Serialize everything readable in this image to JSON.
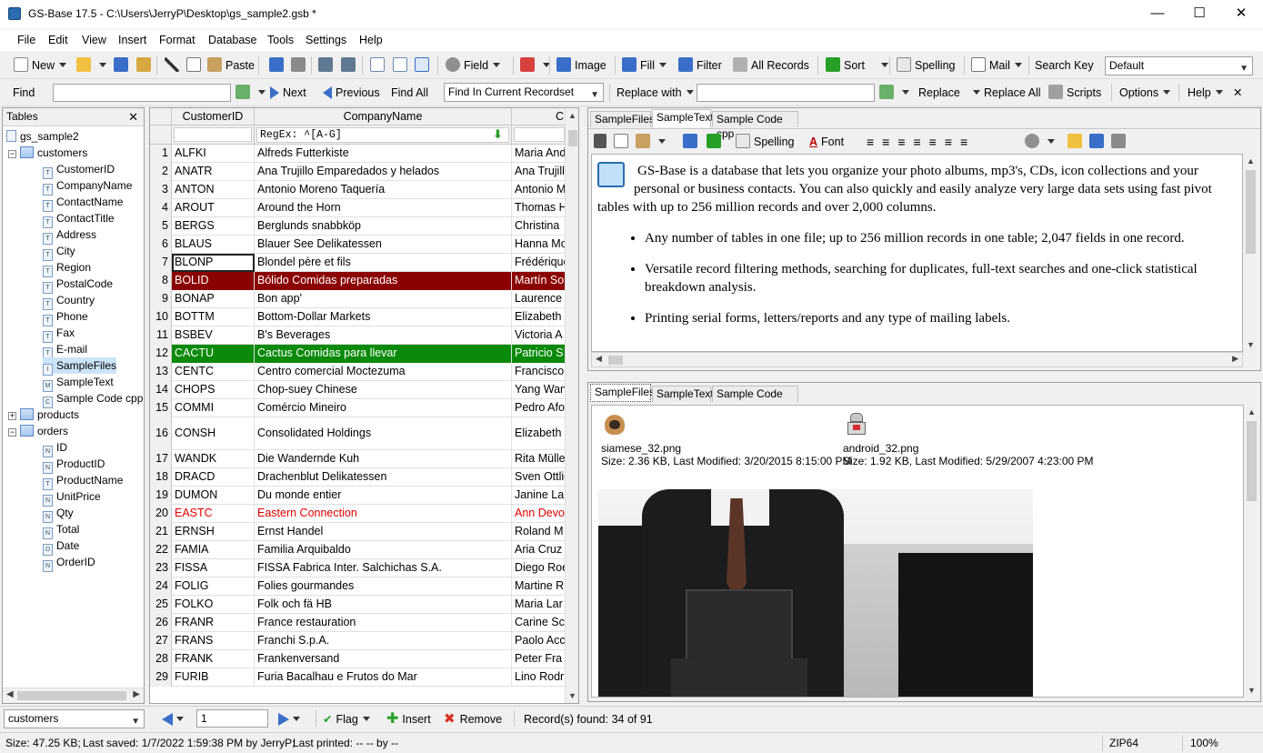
{
  "window": {
    "title": "GS-Base 17.5 - C:\\Users\\JerryP\\Desktop\\gs_sample2.gsb *",
    "minimize": "—",
    "maximize": "☐",
    "close": "✕"
  },
  "menu": [
    "File",
    "Edit",
    "View",
    "Insert",
    "Format",
    "Database",
    "Tools",
    "Settings",
    "Help"
  ],
  "toolbar1": {
    "new": "New",
    "paste": "Paste",
    "field": "Field",
    "image": "Image",
    "fill": "Fill",
    "filter": "Filter",
    "all_records": "All Records",
    "sort": "Sort",
    "spelling": "Spelling",
    "mail": "Mail",
    "search_key": "Search Key",
    "search_key_value": "Default"
  },
  "toolbar2": {
    "find": "Find",
    "find_value": "",
    "next": "Next",
    "previous": "Previous",
    "find_all": "Find All",
    "scope": "Find In Current Recordset",
    "replace_with": "Replace with",
    "replace_value": "",
    "replace": "Replace",
    "replace_all": "Replace All",
    "scripts": "Scripts",
    "options": "Options",
    "help": "Help"
  },
  "tables_panel": {
    "title": "Tables",
    "close": "✕",
    "root": "gs_sample2",
    "tables": [
      {
        "name": "customers",
        "expanded": true,
        "fields": [
          "CustomerID",
          "CompanyName",
          "ContactName",
          "ContactTitle",
          "Address",
          "City",
          "Region",
          "PostalCode",
          "Country",
          "Phone",
          "Fax",
          "E-mail",
          "SampleFiles",
          "SampleText",
          "Sample Code cpp"
        ],
        "field_icons": [
          "T",
          "T",
          "T",
          "T",
          "T",
          "T",
          "T",
          "T",
          "T",
          "T",
          "T",
          "T",
          "I",
          "M",
          "C"
        ]
      },
      {
        "name": "products",
        "expanded": false,
        "fields": []
      },
      {
        "name": "orders",
        "expanded": true,
        "fields": [
          "ID",
          "ProductID",
          "ProductName",
          "UnitPrice",
          "Qty",
          "Total",
          "Date",
          "OrderID"
        ],
        "field_icons": [
          "N",
          "N",
          "T",
          "N",
          "N",
          "N",
          "D",
          "N"
        ]
      }
    ],
    "selected_field": "SampleFiles"
  },
  "grid": {
    "columns": [
      "CustomerID",
      "CompanyName",
      "C"
    ],
    "filter": "RegEx: ^[A-G]",
    "rows": [
      {
        "n": "1",
        "id": "ALFKI",
        "company": "Alfreds Futterkiste",
        "contact": "Maria Anders"
      },
      {
        "n": "2",
        "id": "ANATR",
        "company": "Ana Trujillo Emparedados y helados",
        "contact": "Ana Trujillo"
      },
      {
        "n": "3",
        "id": "ANTON",
        "company": "Antonio Moreno Taquería",
        "contact": "Antonio Moreno"
      },
      {
        "n": "4",
        "id": "AROUT",
        "company": "Around the Horn",
        "contact": "Thomas Hardy"
      },
      {
        "n": "5",
        "id": "BERGS",
        "company": "Berglunds snabbköp",
        "contact": "Christina"
      },
      {
        "n": "6",
        "id": "BLAUS",
        "company": "Blauer See Delikatessen",
        "contact": "Hanna Moos"
      },
      {
        "n": "7",
        "id": "BLONP",
        "company": "Blondel père et fils",
        "contact": "Frédérique"
      },
      {
        "n": "8",
        "id": "BOLID",
        "company": "Bólido Comidas preparadas",
        "contact": "Martín Sommer",
        "style": "red"
      },
      {
        "n": "9",
        "id": "BONAP",
        "company": "Bon app'",
        "contact": "Laurence"
      },
      {
        "n": "10",
        "id": "BOTTM",
        "company": "Bottom-Dollar Markets",
        "contact": "Elizabeth"
      },
      {
        "n": "11",
        "id": "BSBEV",
        "company": "B's Beverages",
        "contact": "Victoria A"
      },
      {
        "n": "12",
        "id": "CACTU",
        "company": "Cactus Comidas para llevar",
        "contact": "Patricio S",
        "style": "green"
      },
      {
        "n": "13",
        "id": "CENTC",
        "company": "Centro comercial Moctezuma",
        "contact": "Francisco"
      },
      {
        "n": "14",
        "id": "CHOPS",
        "company": "Chop-suey Chinese",
        "contact": "Yang Wang"
      },
      {
        "n": "15",
        "id": "COMMI",
        "company": "Comércio Mineiro",
        "contact": "Pedro Afonso"
      },
      {
        "n": "16",
        "id": "CONSH",
        "company": "Consolidated Holdings",
        "contact": "Elizabeth",
        "tall": true
      },
      {
        "n": "17",
        "id": "WANDK",
        "company": "Die Wandernde Kuh",
        "contact": "Rita Müller"
      },
      {
        "n": "18",
        "id": "DRACD",
        "company": "Drachenblut Delikatessen",
        "contact": "Sven Ottlieb"
      },
      {
        "n": "19",
        "id": "DUMON",
        "company": "Du monde entier",
        "contact": "Janine La"
      },
      {
        "n": "20",
        "id": "EASTC",
        "company": "Eastern Connection",
        "contact": "Ann Devon",
        "style": "txtred"
      },
      {
        "n": "21",
        "id": "ERNSH",
        "company": "Ernst Handel",
        "contact": "Roland M"
      },
      {
        "n": "22",
        "id": "FAMIA",
        "company": "Familia Arquibaldo",
        "contact": "Aria Cruz"
      },
      {
        "n": "23",
        "id": "FISSA",
        "company": "FISSA Fabrica Inter. Salchichas S.A.",
        "contact": "Diego Roel"
      },
      {
        "n": "24",
        "id": "FOLIG",
        "company": "Folies gourmandes",
        "contact": "Martine R"
      },
      {
        "n": "25",
        "id": "FOLKO",
        "company": "Folk och fä HB",
        "contact": "Maria Lar"
      },
      {
        "n": "26",
        "id": "FRANR",
        "company": "France restauration",
        "contact": "Carine Sc"
      },
      {
        "n": "27",
        "id": "FRANS",
        "company": "Franchi S.p.A.",
        "contact": "Paolo Acc"
      },
      {
        "n": "28",
        "id": "FRANK",
        "company": "Frankenversand",
        "contact": "Peter Fra"
      },
      {
        "n": "29",
        "id": "FURIB",
        "company": "Furia Bacalhau e Frutos do Mar",
        "contact": "Lino Rodr"
      }
    ]
  },
  "doc_top": {
    "tabs": [
      "SampleFiles",
      "SampleText",
      "Sample Code cpp"
    ],
    "active": 1,
    "spelling": "Spelling",
    "font": "Font",
    "intro": "GS-Base is a database that lets you organize your photo albums, mp3's, CDs, icon collections and your personal or business contacts. You can also quickly and easily analyze very large data sets using fast pivot tables with up to 256 million records and over 2,000 columns.",
    "bullets": [
      "Any number of tables in one file; up to 256 million records in one table; 2,047 fields in one record.",
      "Versatile record filtering methods, searching for duplicates, full-text searches and one-click statistical breakdown analysis.",
      "Printing serial forms, letters/reports and any type of mailing labels."
    ]
  },
  "doc_bottom": {
    "tabs": [
      "SampleFiles",
      "SampleText",
      "Sample Code cpp"
    ],
    "active": 0,
    "files": [
      {
        "name": "siamese_32.png",
        "meta": "Size: 2.36 KB, Last Modified: 3/20/2015 8:15:00 PM"
      },
      {
        "name": "android_32.png",
        "meta": "Size: 1.92 KB, Last Modified: 5/29/2007 4:23:00 PM"
      }
    ]
  },
  "bottombar": {
    "table": "customers",
    "record_no": "1",
    "flag": "Flag",
    "insert": "Insert",
    "remove": "Remove",
    "records_found": "Record(s) found: 34 of 91"
  },
  "status": {
    "size": "Size: 47.25 KB;",
    "saved": "Last saved: 1/7/2022 1:59:38 PM by JerryP;",
    "printed": "Last printed: -- -- by --",
    "zip": "ZIP64",
    "zoom": "100%"
  },
  "colors": {
    "accent": "#0a64c8",
    "row_red": "#8b0000",
    "row_green": "#0a8a0a",
    "text_red": "#e00000"
  }
}
